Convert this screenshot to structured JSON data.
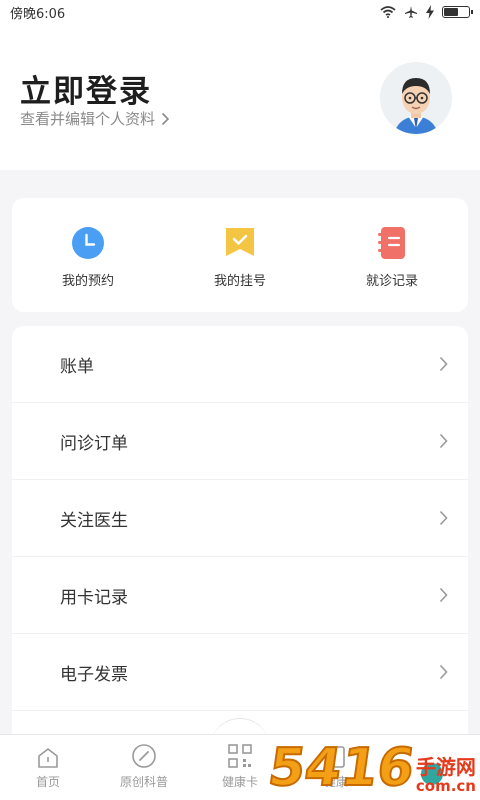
{
  "status_bar": {
    "time": "傍晚6:06"
  },
  "header": {
    "title": "立即登录",
    "subtitle": "查看并编辑个人资料",
    "chevron": "›"
  },
  "quick_actions": [
    {
      "label": "我的预约",
      "icon": "clock-icon",
      "color": "#4a9ff5"
    },
    {
      "label": "我的挂号",
      "icon": "ticket-check-icon",
      "color": "#f4c542"
    },
    {
      "label": "就诊记录",
      "icon": "notebook-icon",
      "color": "#f07167"
    }
  ],
  "menu": [
    {
      "label": "账单"
    },
    {
      "label": "问诊订单"
    },
    {
      "label": "关注医生"
    },
    {
      "label": "用卡记录"
    },
    {
      "label": "电子发票"
    }
  ],
  "tab_bar": [
    {
      "label": "首页",
      "icon": "home-icon"
    },
    {
      "label": "原创科普",
      "icon": "compass-icon"
    },
    {
      "label": "健康卡",
      "icon": "qr-code-icon"
    },
    {
      "label": "健康",
      "icon": "document-icon"
    },
    {
      "label": "",
      "icon": "profile-icon"
    }
  ],
  "colors": {
    "accent": "#4a9ff5",
    "background": "#f5f5f7"
  },
  "watermark": {
    "big": "5416",
    "cn": "手游网",
    "url": "com.cn"
  }
}
